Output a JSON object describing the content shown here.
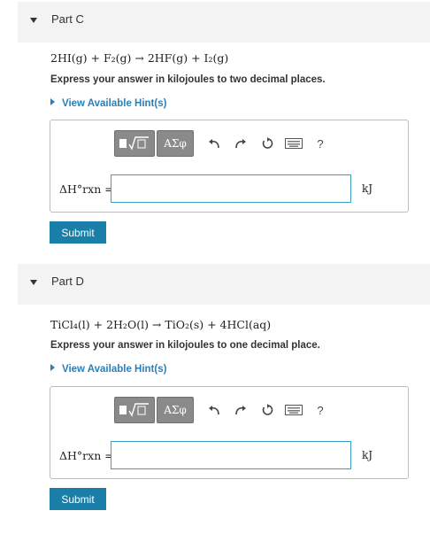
{
  "partC": {
    "title": "Part C",
    "equation": "2HI(g) + F₂(g) → 2HF(g) + I₂(g)",
    "instruction": "Express your answer in kilojoules to two decimal places.",
    "hint": "View Available Hint(s)",
    "toolbar": {
      "template_label": "▯√▯",
      "symbols_label": "ΑΣφ",
      "help_label": "?"
    },
    "var_label": "ΔH°rxn =",
    "input_value": "",
    "unit": "kJ",
    "submit": "Submit"
  },
  "partD": {
    "title": "Part D",
    "equation": "TiCl₄(l) + 2H₂O(l) → TiO₂(s) + 4HCl(aq)",
    "instruction": "Express your answer in kilojoules to one decimal place.",
    "hint": "View Available Hint(s)",
    "toolbar": {
      "template_label": "▯√▯",
      "symbols_label": "ΑΣφ",
      "help_label": "?"
    },
    "var_label": "ΔH°rxn =",
    "input_value": "",
    "unit": "kJ",
    "submit": "Submit"
  }
}
